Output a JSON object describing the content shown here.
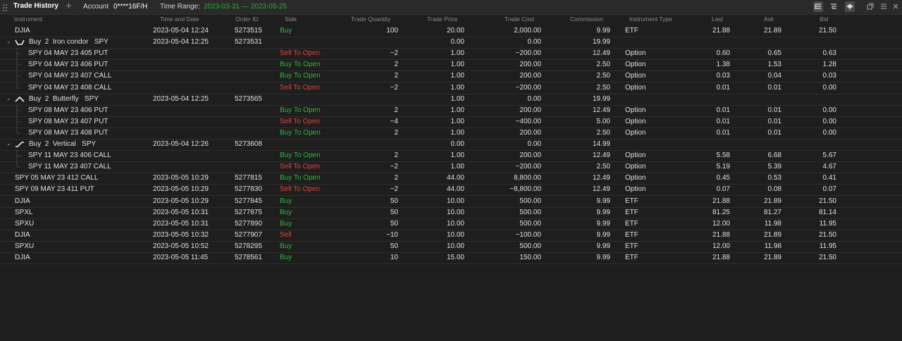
{
  "window": {
    "title": "Trade History",
    "account_label": "Account",
    "account_value": "0****16F/H",
    "range_label": "Time Range:",
    "range_value": "2023-03-31 — 2023-05-25"
  },
  "columns": {
    "instrument": "Instrument",
    "time": "Time and Date",
    "order": "Order ID",
    "side": "Side",
    "qty": "Trade Quantity",
    "price": "Trade Price",
    "cost": "Trade Cost",
    "commission": "Commission",
    "type": "Instrument Type",
    "last": "Last",
    "ask": "Ask",
    "bid": "Bid"
  },
  "rows": [
    {
      "instrument": "DJIA",
      "time": "2023-05-04 12:24",
      "order": "5273515",
      "side": "Buy",
      "qty": "100",
      "price": "20.00",
      "cost": "2,000.00",
      "commission": "9.99",
      "type": "ETF",
      "last": "21.88",
      "ask": "21.89",
      "bid": "21.50"
    },
    {
      "instrument": "Buy  2  Iron condor   SPY",
      "time": "2023-05-04 12:25",
      "order": "5273531",
      "side": "",
      "qty": "",
      "price": "0.00",
      "cost": "0.00",
      "commission": "19.99",
      "type": "",
      "last": "",
      "ask": "",
      "bid": ""
    },
    {
      "instrument": "SPY 04 MAY 23 405 PUT",
      "time": "",
      "order": "",
      "side": "Sell To Open",
      "qty": "−2",
      "price": "1.00",
      "cost": "−200.00",
      "commission": "12.49",
      "type": "Option",
      "last": "0.60",
      "ask": "0.65",
      "bid": "0.63"
    },
    {
      "instrument": "SPY 04 MAY 23 406 PUT",
      "time": "",
      "order": "",
      "side": "Buy To Open",
      "qty": "2",
      "price": "1.00",
      "cost": "200.00",
      "commission": "2.50",
      "type": "Option",
      "last": "1.38",
      "ask": "1.53",
      "bid": "1.28"
    },
    {
      "instrument": "SPY 04 MAY 23 407 CALL",
      "time": "",
      "order": "",
      "side": "Buy To Open",
      "qty": "2",
      "price": "1.00",
      "cost": "200.00",
      "commission": "2.50",
      "type": "Option",
      "last": "0.03",
      "ask": "0.04",
      "bid": "0.03"
    },
    {
      "instrument": "SPY 04 MAY 23 408 CALL",
      "time": "",
      "order": "",
      "side": "Sell To Open",
      "qty": "−2",
      "price": "1.00",
      "cost": "−200.00",
      "commission": "2.50",
      "type": "Option",
      "last": "0.01",
      "ask": "0.01",
      "bid": "0.00"
    },
    {
      "instrument": "Buy  2  Butterfly   SPY",
      "time": "2023-05-04 12:25",
      "order": "5273565",
      "side": "",
      "qty": "",
      "price": "1.00",
      "cost": "0.00",
      "commission": "19.99",
      "type": "",
      "last": "",
      "ask": "",
      "bid": ""
    },
    {
      "instrument": "SPY 08 MAY 23 406 PUT",
      "time": "",
      "order": "",
      "side": "Buy To Open",
      "qty": "2",
      "price": "1.00",
      "cost": "200.00",
      "commission": "12.49",
      "type": "Option",
      "last": "0.01",
      "ask": "0.01",
      "bid": "0.00"
    },
    {
      "instrument": "SPY 08 MAY 23 407 PUT",
      "time": "",
      "order": "",
      "side": "Sell To Open",
      "qty": "−4",
      "price": "1.00",
      "cost": "−400.00",
      "commission": "5.00",
      "type": "Option",
      "last": "0.01",
      "ask": "0.01",
      "bid": "0.00"
    },
    {
      "instrument": "SPY 08 MAY 23 408 PUT",
      "time": "",
      "order": "",
      "side": "Buy To Open",
      "qty": "2",
      "price": "1.00",
      "cost": "200.00",
      "commission": "2.50",
      "type": "Option",
      "last": "0.01",
      "ask": "0.01",
      "bid": "0.00"
    },
    {
      "instrument": "Buy  2  Vertical   SPY",
      "time": "2023-05-04 12:26",
      "order": "5273608",
      "side": "",
      "qty": "",
      "price": "0.00",
      "cost": "0.00",
      "commission": "14.99",
      "type": "",
      "last": "",
      "ask": "",
      "bid": ""
    },
    {
      "instrument": "SPY 11 MAY 23 406 CALL",
      "time": "",
      "order": "",
      "side": "Buy To Open",
      "qty": "2",
      "price": "1.00",
      "cost": "200.00",
      "commission": "12.49",
      "type": "Option",
      "last": "5.58",
      "ask": "6.68",
      "bid": "5.67"
    },
    {
      "instrument": "SPY 11 MAY 23 407 CALL",
      "time": "",
      "order": "",
      "side": "Sell To Open",
      "qty": "−2",
      "price": "1.00",
      "cost": "−200.00",
      "commission": "2.50",
      "type": "Option",
      "last": "5.19",
      "ask": "5.39",
      "bid": "4.67"
    },
    {
      "instrument": "SPY 05 MAY 23 412 CALL",
      "time": "2023-05-05 10:29",
      "order": "5277815",
      "side": "Buy To Open",
      "qty": "2",
      "price": "44.00",
      "cost": "8,800.00",
      "commission": "12.49",
      "type": "Option",
      "last": "0.45",
      "ask": "0.53",
      "bid": "0.41"
    },
    {
      "instrument": "SPY 09 MAY 23 411 PUT",
      "time": "2023-05-05 10:29",
      "order": "5277830",
      "side": "Sell To Open",
      "qty": "−2",
      "price": "44.00",
      "cost": "−8,800.00",
      "commission": "12.49",
      "type": "Option",
      "last": "0.07",
      "ask": "0.08",
      "bid": "0.07"
    },
    {
      "instrument": "DJIA",
      "time": "2023-05-05 10:29",
      "order": "5277845",
      "side": "Buy",
      "qty": "50",
      "price": "10.00",
      "cost": "500.00",
      "commission": "9.99",
      "type": "ETF",
      "last": "21.88",
      "ask": "21.89",
      "bid": "21.50"
    },
    {
      "instrument": "SPXL",
      "time": "2023-05-05 10:31",
      "order": "5277875",
      "side": "Buy",
      "qty": "50",
      "price": "10.00",
      "cost": "500.00",
      "commission": "9.99",
      "type": "ETF",
      "last": "81.25",
      "ask": "81.27",
      "bid": "81.14"
    },
    {
      "instrument": "SPXU",
      "time": "2023-05-05 10:31",
      "order": "5277890",
      "side": "Buy",
      "qty": "50",
      "price": "10.00",
      "cost": "500.00",
      "commission": "9.99",
      "type": "ETF",
      "last": "12.00",
      "ask": "11.98",
      "bid": "11.95"
    },
    {
      "instrument": "DJIA",
      "time": "2023-05-05 10:32",
      "order": "5277907",
      "side": "Sell",
      "qty": "−10",
      "price": "10.00",
      "cost": "−100.00",
      "commission": "9.99",
      "type": "ETF",
      "last": "21.88",
      "ask": "21.89",
      "bid": "21.50"
    },
    {
      "instrument": "SPXU",
      "time": "2023-05-05 10:52",
      "order": "5278295",
      "side": "Buy",
      "qty": "50",
      "price": "10.00",
      "cost": "500.00",
      "commission": "9.99",
      "type": "ETF",
      "last": "12.00",
      "ask": "11.98",
      "bid": "11.95"
    },
    {
      "instrument": "DJIA",
      "time": "2023-05-05 11:45",
      "order": "5278561",
      "side": "Buy",
      "qty": "10",
      "price": "15.00",
      "cost": "150.00",
      "commission": "9.99",
      "type": "ETF",
      "last": "21.88",
      "ask": "21.89",
      "bid": "21.50"
    }
  ],
  "row_kinds": [
    "plain",
    "group-condor",
    "leg",
    "leg",
    "leg",
    "leg-last",
    "group-butterfly",
    "leg",
    "leg",
    "leg-last",
    "group-vertical",
    "leg",
    "leg-last",
    "plain",
    "plain",
    "plain",
    "plain",
    "plain",
    "plain",
    "plain",
    "plain"
  ],
  "icons": [
    "drag-handle-icon",
    "add-tab-icon",
    "list-view-icon",
    "filter-view-icon",
    "link-icon",
    "popout-icon",
    "menu-icon",
    "close-icon",
    "chevron-down-icon",
    "iron-condor-icon",
    "butterfly-icon",
    "vertical-icon"
  ],
  "colors": {
    "buy": "#2fb83b",
    "sell": "#e8423a",
    "range": "#2faa3a",
    "background": "#1e1e1e"
  }
}
